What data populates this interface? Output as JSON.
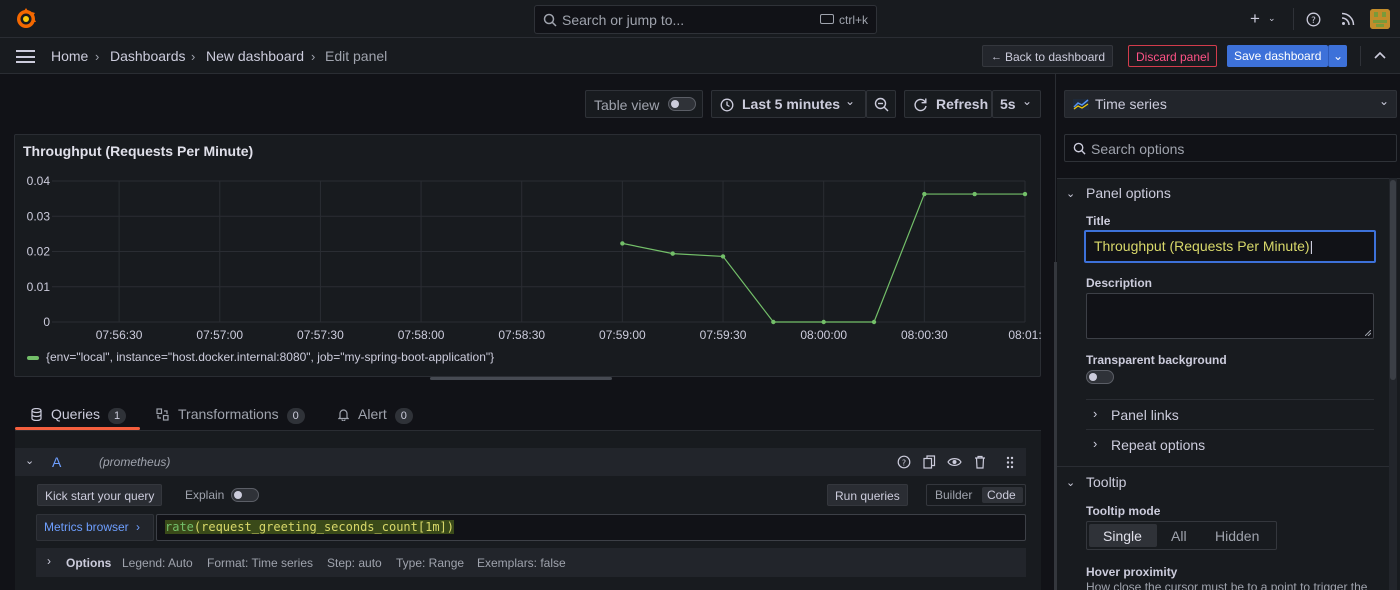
{
  "topbar": {
    "search_placeholder": "Search or jump to...",
    "search_shortcut": "ctrl+k"
  },
  "breadcrumb": {
    "items": [
      "Home",
      "Dashboards",
      "New dashboard",
      "Edit panel"
    ],
    "separator": "›"
  },
  "actions": {
    "back": "Back to dashboard",
    "discard": "Discard panel",
    "save": "Save dashboard"
  },
  "toolbar": {
    "table_view": "Table view",
    "time_range": "Last 5 minutes",
    "refresh": "Refresh",
    "refresh_interval": "5s"
  },
  "panel": {
    "title": "Throughput (Requests Per Minute)",
    "legend": "{env=\"local\", instance=\"host.docker.internal:8080\", job=\"my-spring-boot-application\"}"
  },
  "chart_data": {
    "type": "line",
    "title": "Throughput (Requests Per Minute)",
    "xlabel": "",
    "ylabel": "",
    "x_ticks": [
      "07:56:30",
      "07:57:00",
      "07:57:30",
      "07:58:00",
      "07:58:30",
      "07:59:00",
      "07:59:30",
      "08:00:00",
      "08:00:30",
      "08:01:"
    ],
    "y_ticks": [
      "0.04",
      "0.03",
      "0.02",
      "0.01",
      "0"
    ],
    "ylim": [
      0,
      0.04
    ],
    "xlim": [
      "07:56:10",
      "08:01:00"
    ],
    "grid": true,
    "legend_placement": "bottom-left",
    "series": [
      {
        "name": "{env=\"local\", instance=\"host.docker.internal:8080\", job=\"my-spring-boot-application\"}",
        "color": "#73bf69",
        "x": [
          "07:59:00",
          "07:59:15",
          "07:59:30",
          "07:59:45",
          "08:00:00",
          "08:00:15",
          "08:00:30",
          "08:00:45",
          "08:01:00"
        ],
        "y": [
          0.0223,
          0.0194,
          0.0186,
          0,
          0,
          0,
          0.0363,
          0.0363,
          0.0363
        ]
      }
    ]
  },
  "query_tabs": [
    {
      "label": "Queries",
      "count": "1"
    },
    {
      "label": "Transformations",
      "count": "0"
    },
    {
      "label": "Alert",
      "count": "0"
    }
  ],
  "query": {
    "ref": "A",
    "datasource": "(prometheus)",
    "kickstart": "Kick start your query",
    "explain": "Explain",
    "run": "Run queries",
    "builder": "Builder",
    "code": "Code",
    "metrics_browser": "Metrics browser",
    "expr_fn": "rate",
    "expr_args": "(request_greeting_seconds_count[1m])",
    "options_label": "Options",
    "options": [
      "Legend: Auto",
      "Format: Time series",
      "Step: auto",
      "Type: Range",
      "Exemplars: false"
    ]
  },
  "options_pane": {
    "visualization": "Time series",
    "search_placeholder": "Search options",
    "panel_options": "Panel options",
    "title_label": "Title",
    "title_value": "Throughput (Requests Per Minute)",
    "description_label": "Description",
    "transparent_label": "Transparent background",
    "panel_links": "Panel links",
    "repeat_options": "Repeat options",
    "tooltip": "Tooltip",
    "tooltip_mode_label": "Tooltip mode",
    "tooltip_modes": [
      "Single",
      "All",
      "Hidden"
    ],
    "hover_proximity": "Hover proximity",
    "hover_desc": "How close the cursor must be to a point to trigger the"
  },
  "colors": {
    "accent": "#3d71d9",
    "series": "#73bf69",
    "danger": "#d23c4c",
    "tab_underline": "#f55f3e"
  }
}
